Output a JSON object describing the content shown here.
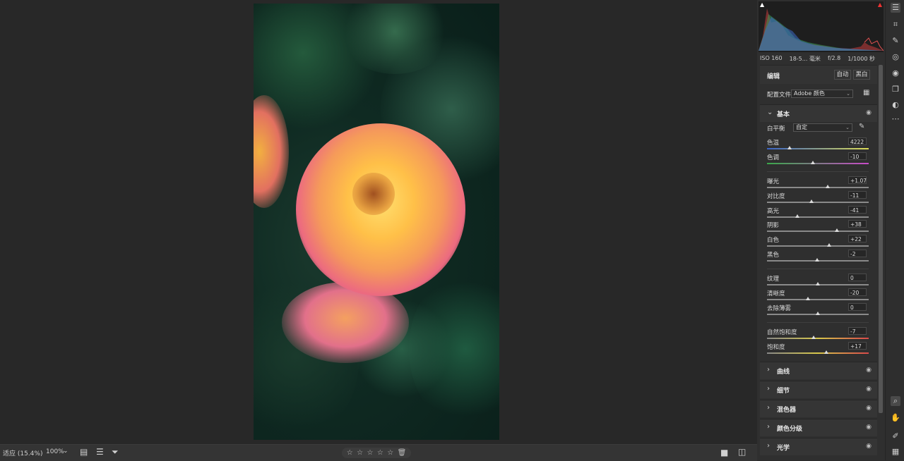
{
  "bottom_bar": {
    "fit_label": "适应 (15.4%)",
    "zoom_value": "100%",
    "stars": [
      "☆",
      "☆",
      "☆",
      "☆",
      "☆"
    ]
  },
  "histogram_info": {
    "iso": "ISO 160",
    "focal": "18-5... 毫米",
    "aperture": "f/2.8",
    "shutter": "1/1000 秒"
  },
  "edit_header": {
    "title": "编辑",
    "auto_label": "自动",
    "bw_label": "黑白"
  },
  "profile": {
    "label": "配置文件",
    "value": "Adobe 颜色"
  },
  "basic": {
    "title": "基本",
    "white_balance_label": "白平衡",
    "white_balance_value": "自定",
    "sliders": [
      {
        "label": "色温",
        "value": "4222",
        "pos": 0.22
      },
      {
        "label": "色调",
        "value": "-10",
        "pos": 0.45
      },
      {
        "label": "曝光",
        "value": "+1.07",
        "pos": 0.6
      },
      {
        "label": "对比度",
        "value": "-11",
        "pos": 0.44
      },
      {
        "label": "高光",
        "value": "-41",
        "pos": 0.3
      },
      {
        "label": "阴影",
        "value": "+38",
        "pos": 0.69
      },
      {
        "label": "白色",
        "value": "+22",
        "pos": 0.61
      },
      {
        "label": "黑色",
        "value": "-2",
        "pos": 0.49
      },
      {
        "label": "纹理",
        "value": "0",
        "pos": 0.5
      },
      {
        "label": "清晰度",
        "value": "-20",
        "pos": 0.4
      },
      {
        "label": "去除薄雾",
        "value": "0",
        "pos": 0.5
      },
      {
        "label": "自然饱和度",
        "value": "-7",
        "pos": 0.46
      },
      {
        "label": "饱和度",
        "value": "+17",
        "pos": 0.58
      }
    ]
  },
  "sections": [
    {
      "label": "曲线"
    },
    {
      "label": "细节"
    },
    {
      "label": "混色器"
    },
    {
      "label": "颜色分级"
    },
    {
      "label": "光学"
    }
  ],
  "colors": {
    "temp_track": "linear-gradient(to right,#3a64c8,#dcdc55)",
    "tint_track": "linear-gradient(to right,#3aa84a,#c84ac8)",
    "sat_track": "linear-gradient(to right,#888,#d8c84a,#d84a4a)"
  }
}
